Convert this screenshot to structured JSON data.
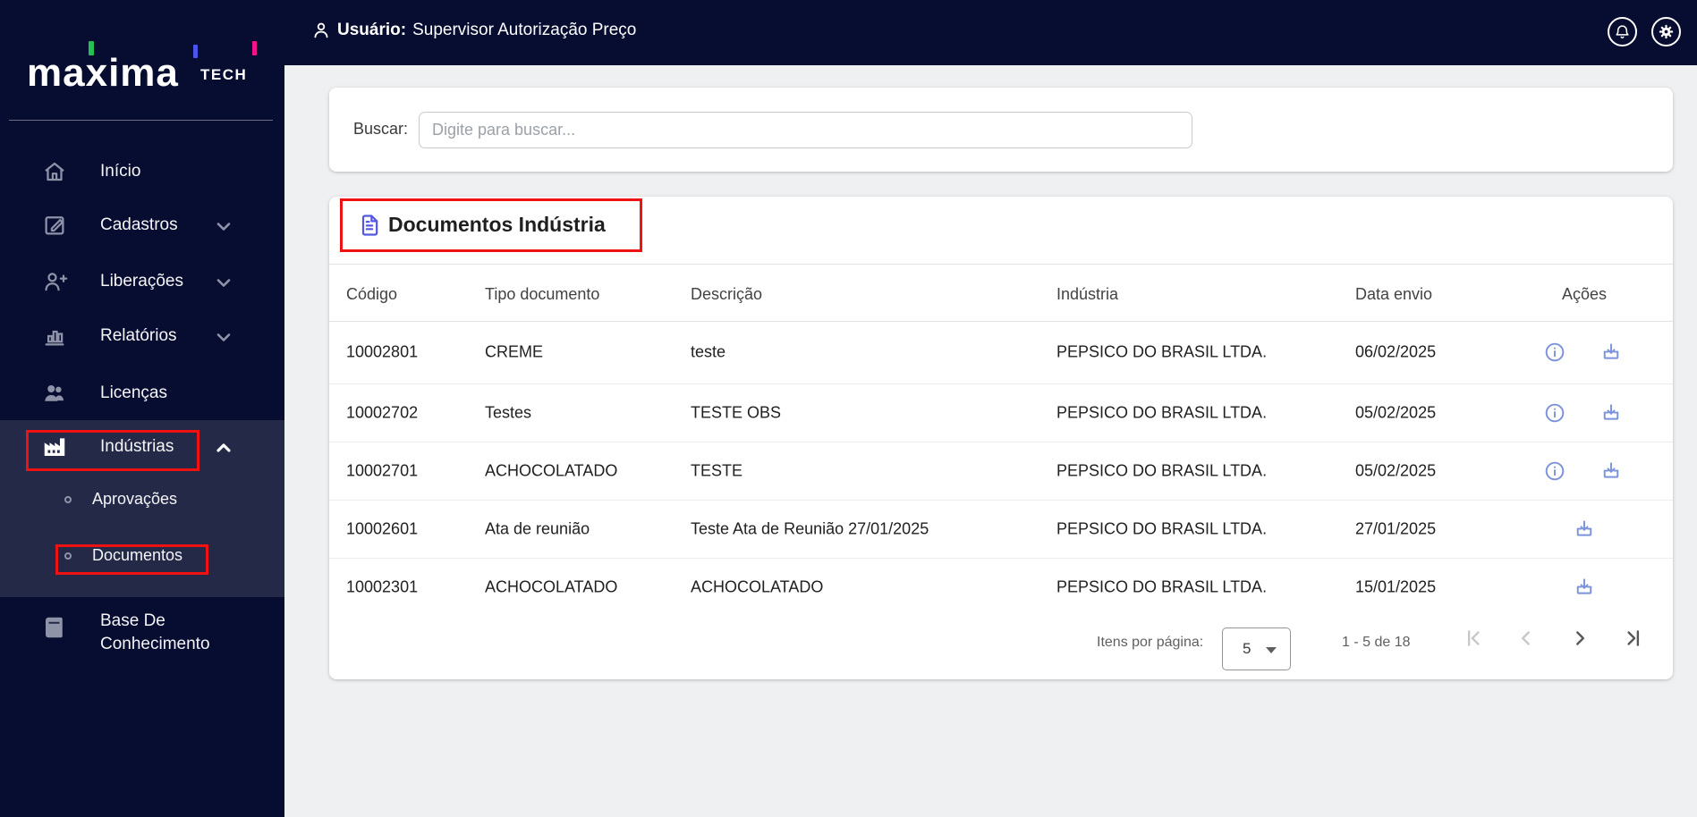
{
  "brand": {
    "name_main": "maxima",
    "name_sub": "TECH"
  },
  "header": {
    "collapse_glyph": "«",
    "user_label": "Usuário:",
    "user_name": "Supervisor Autorização Preço"
  },
  "sidebar": {
    "items": [
      {
        "label": "Início",
        "icon": "home"
      },
      {
        "label": "Cadastros",
        "icon": "edit-square",
        "chevron": "down"
      },
      {
        "label": "Liberações",
        "icon": "person-add",
        "chevron": "down"
      },
      {
        "label": "Relatórios",
        "icon": "bar-chart",
        "chevron": "down"
      },
      {
        "label": "Licenças",
        "icon": "people"
      },
      {
        "label": "Indústrias",
        "icon": "factory",
        "chevron": "up",
        "active": true
      },
      {
        "label": "Aprovações",
        "submenu_of": "Indústrias"
      },
      {
        "label": "Documentos",
        "submenu_of": "Indústrias",
        "active": true
      },
      {
        "label": "Base De Conhecimento",
        "icon": "book"
      }
    ]
  },
  "search": {
    "label": "Buscar:",
    "placeholder": "Digite para buscar..."
  },
  "table": {
    "title": "Documentos Indústria",
    "columns": [
      "Código",
      "Tipo documento",
      "Descrição",
      "Indústria",
      "Data envio",
      "Ações"
    ],
    "rows": [
      {
        "codigo": "10002801",
        "tipo": "CREME",
        "descricao": "teste",
        "industria": "PEPSICO DO BRASIL LTDA.",
        "data_envio": "06/02/2025",
        "actions": [
          "info",
          "download"
        ]
      },
      {
        "codigo": "10002702",
        "tipo": "Testes",
        "descricao": "TESTE OBS",
        "industria": "PEPSICO DO BRASIL LTDA.",
        "data_envio": "05/02/2025",
        "actions": [
          "info",
          "download"
        ]
      },
      {
        "codigo": "10002701",
        "tipo": "ACHOCOLATADO",
        "descricao": "TESTE",
        "industria": "PEPSICO DO BRASIL LTDA.",
        "data_envio": "05/02/2025",
        "actions": [
          "info",
          "download"
        ]
      },
      {
        "codigo": "10002601",
        "tipo": "Ata de reunião",
        "descricao": "Teste Ata de Reunião 27/01/2025",
        "industria": "PEPSICO DO BRASIL LTDA.",
        "data_envio": "27/01/2025",
        "actions": [
          "download"
        ]
      },
      {
        "codigo": "10002301",
        "tipo": "ACHOCOLATADO",
        "descricao": "ACHOCOLATADO",
        "industria": "PEPSICO DO BRASIL LTDA.",
        "data_envio": "15/01/2025",
        "actions": [
          "download"
        ]
      }
    ]
  },
  "pagination": {
    "items_label": "Itens por página:",
    "page_size": "5",
    "range": "1 - 5 de 18",
    "first_enabled": false,
    "prev_enabled": false,
    "next_enabled": true,
    "last_enabled": true
  },
  "colors": {
    "navy": "#070c31",
    "sidebar_highlight": "#232947",
    "annotation_red": "#ee1212",
    "title_icon_indigo": "#5457e0",
    "action_icon_blue": "#7b93da",
    "logo_green": "#25c052",
    "logo_blue": "#4a55ee",
    "logo_pink": "#f5128f",
    "main_bg": "#eef0f2"
  }
}
